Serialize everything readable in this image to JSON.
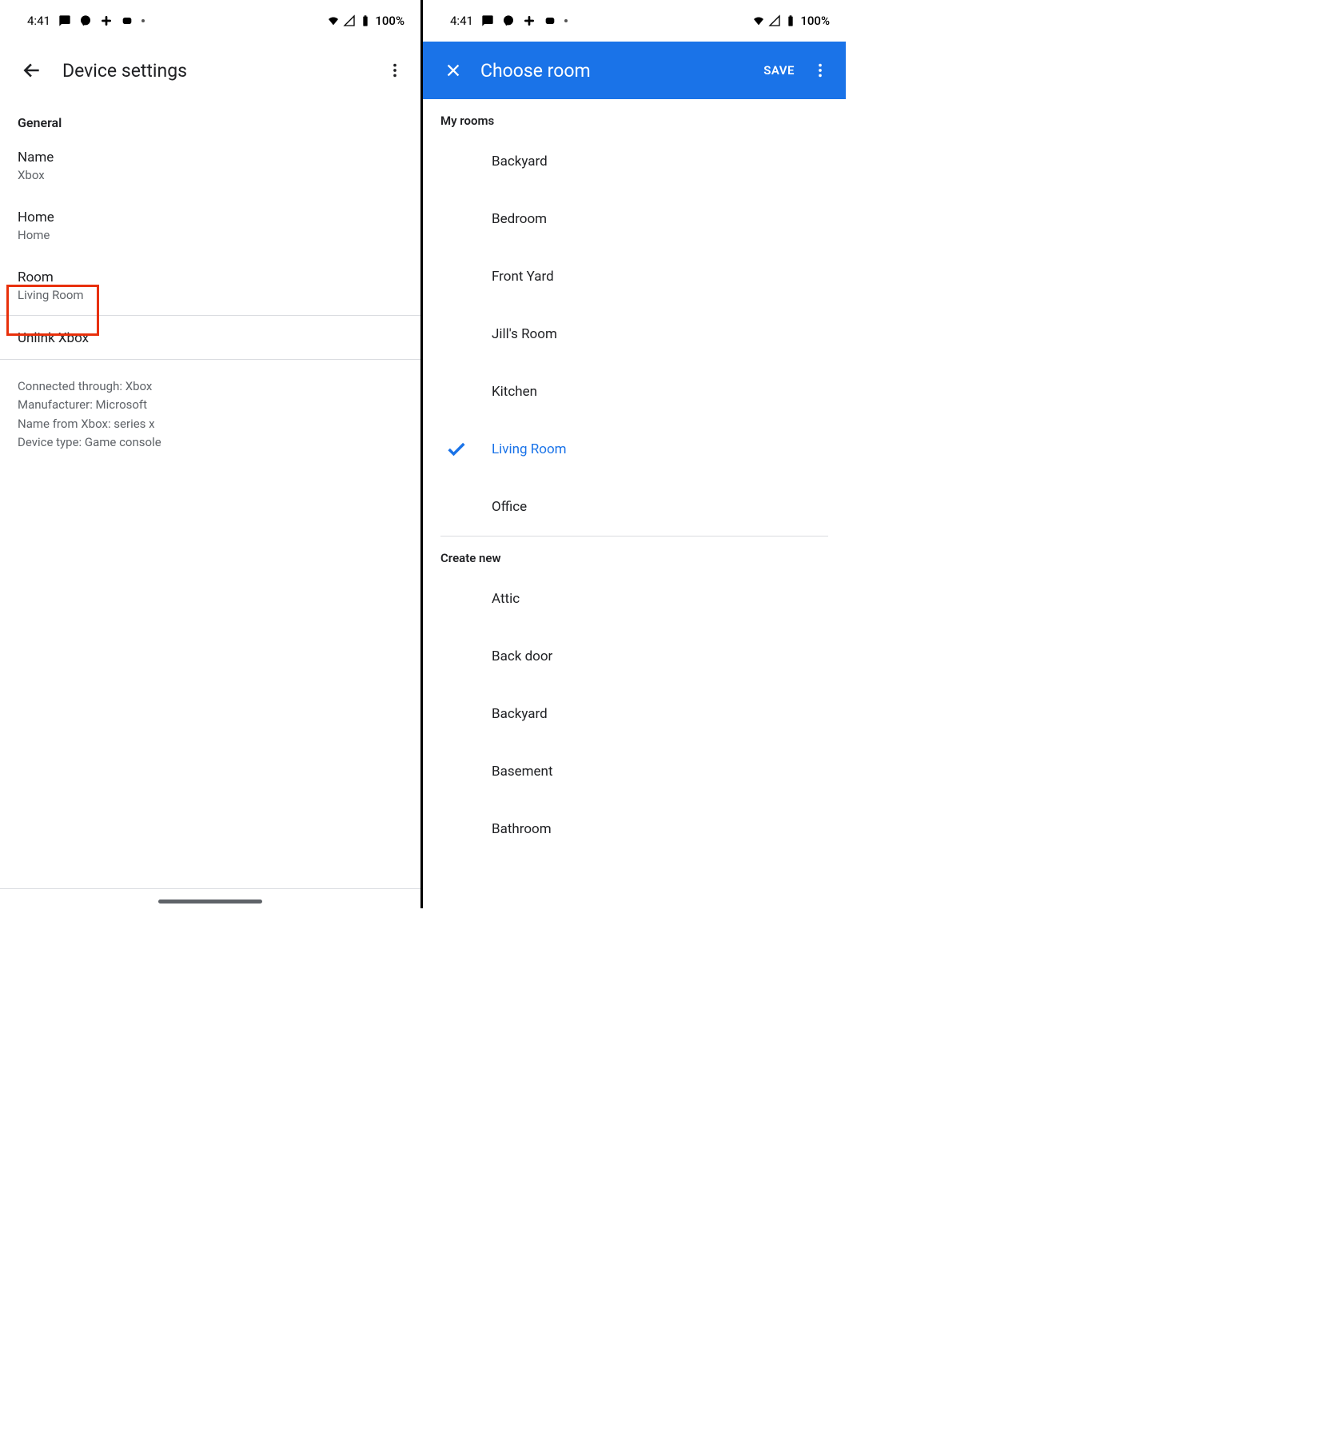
{
  "statusbar": {
    "time": "4:41",
    "battery": "100%"
  },
  "left_screen": {
    "title": "Device settings",
    "general_header": "General",
    "rows": {
      "name": {
        "label": "Name",
        "value": "Xbox"
      },
      "home": {
        "label": "Home",
        "value": "Home"
      },
      "room": {
        "label": "Room",
        "value": "Living Room"
      },
      "unlink": {
        "label": "Unlink Xbox"
      }
    },
    "meta": {
      "connected": "Connected through: Xbox",
      "manufacturer": "Manufacturer: Microsoft",
      "name_from": "Name from Xbox: series x",
      "device_type": "Device type: Game console"
    }
  },
  "right_screen": {
    "title": "Choose room",
    "save_label": "SAVE",
    "my_rooms_header": "My rooms",
    "my_rooms": [
      {
        "label": "Backyard",
        "selected": false
      },
      {
        "label": "Bedroom",
        "selected": false
      },
      {
        "label": "Front Yard",
        "selected": false
      },
      {
        "label": "Jill's Room",
        "selected": false
      },
      {
        "label": "Kitchen",
        "selected": false
      },
      {
        "label": "Living Room",
        "selected": true
      },
      {
        "label": "Office",
        "selected": false
      }
    ],
    "create_new_header": "Create new",
    "create_new": [
      {
        "label": "Attic"
      },
      {
        "label": "Back door"
      },
      {
        "label": "Backyard"
      },
      {
        "label": "Basement"
      },
      {
        "label": "Bathroom"
      }
    ]
  }
}
